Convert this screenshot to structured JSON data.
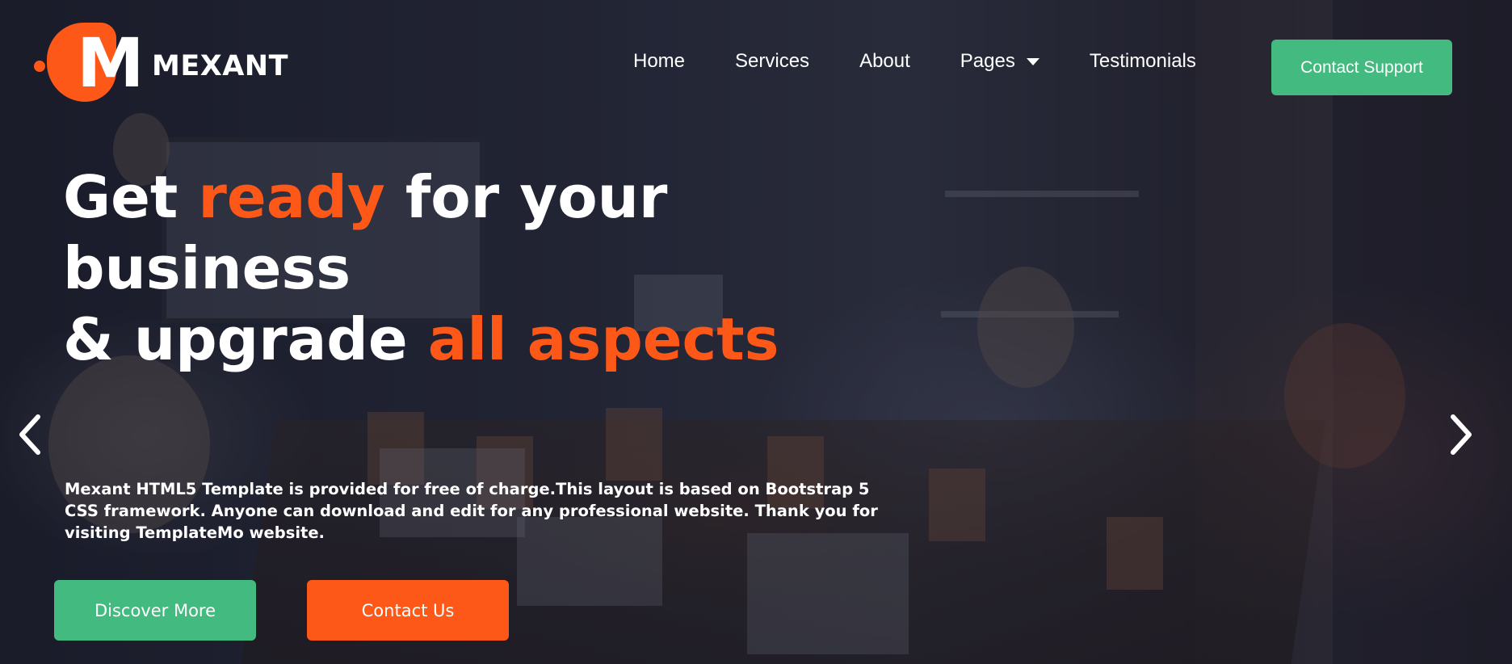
{
  "brand": {
    "logo_letter": "M",
    "name": "MEXANT"
  },
  "nav": {
    "items": [
      {
        "label": "Home"
      },
      {
        "label": "Services"
      },
      {
        "label": "About"
      },
      {
        "label": "Pages"
      },
      {
        "label": "Testimonials"
      }
    ],
    "support_button": "Contact Support"
  },
  "hero": {
    "title_line1_a": "Get ",
    "title_line1_accent": "ready",
    "title_line1_b": " for your",
    "title_line2": "business",
    "title_line3_a": "& upgrade ",
    "title_line3_accent": "all aspects",
    "description": "Mexant HTML5 Template is provided for free of charge.This layout is based on Bootstrap 5 CSS framework. Anyone can download and edit for any professional website. Thank you for visiting TemplateMo website.",
    "discover_button": "Discover More",
    "contact_button": "Contact Us"
  },
  "icons": {
    "prev": "chevron-left-icon",
    "next": "chevron-right-icon",
    "dropdown": "caret-down-icon"
  },
  "colors": {
    "accent_orange": "#fe5818",
    "accent_green": "#43ba7f",
    "text": "#ffffff"
  }
}
